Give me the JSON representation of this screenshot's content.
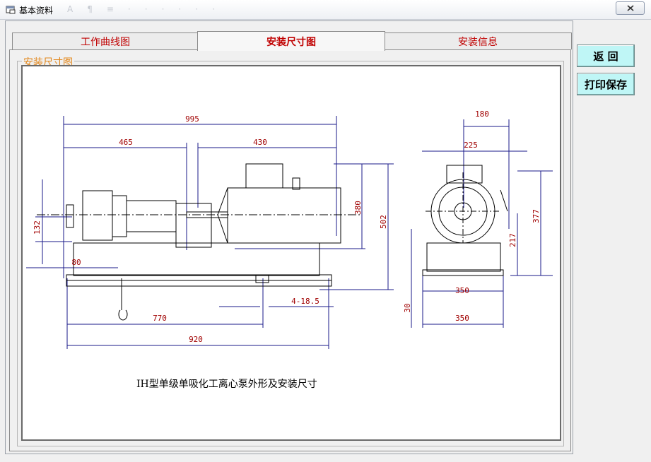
{
  "window": {
    "title": "基本资料",
    "close_icon": "close-icon"
  },
  "tabs": [
    {
      "label": "工作曲线图",
      "active": false
    },
    {
      "label": "安装尺寸图",
      "active": true
    },
    {
      "label": "安装信息",
      "active": false
    }
  ],
  "group": {
    "label": "安装尺寸图"
  },
  "drawing": {
    "caption": "IH型单级单吸化工离心泵外形及安装尺寸",
    "dims": {
      "d995": "995",
      "d465": "465",
      "d430": "430",
      "d380": "380",
      "d502": "502",
      "d132": "132",
      "d80": "80",
      "d770": "770",
      "d920": "920",
      "d4_18_5": "4-18.5",
      "d180": "180",
      "d225": "225",
      "d377": "377",
      "d217": "217",
      "d350a": "350",
      "d350b": "350",
      "d30": "30"
    }
  },
  "buttons": {
    "back": "返  回",
    "print_save": "打印保存"
  }
}
